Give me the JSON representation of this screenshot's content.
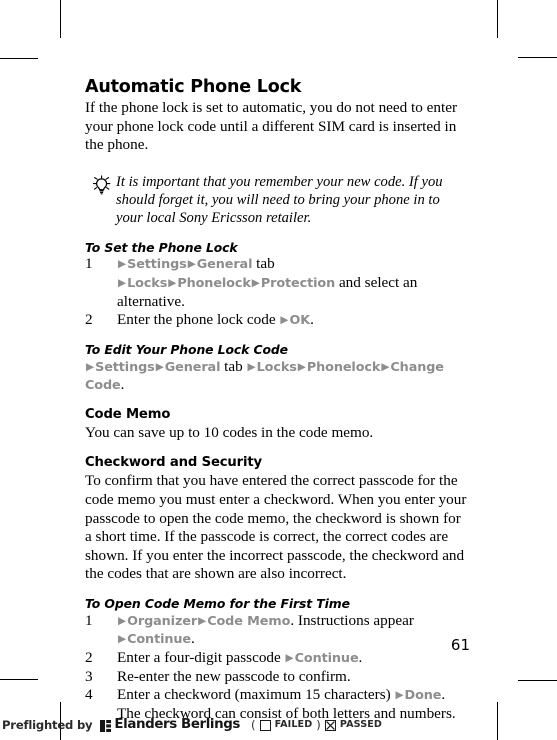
{
  "document": {
    "page_number": "61"
  },
  "sections": {
    "automatic_phone_lock": {
      "heading": "Automatic Phone Lock",
      "body": "If the phone lock is set to automatic, you do not need to enter your phone lock code until a different SIM card is inserted in the phone.",
      "tip": {
        "icon": "lightbulb-tip-icon",
        "text": "It is important that you remember your new code. If you should forget it, you will need to bring your phone in to your local Sony Ericsson retailer."
      }
    },
    "to_set_the_phone_lock": {
      "heading": "To Set the Phone Lock",
      "steps": [
        {
          "number": "1",
          "parts": [
            {
              "type": "arrow",
              "text": "▶"
            },
            {
              "type": "menu",
              "text": "Settings"
            },
            {
              "type": "arrow",
              "text": "▶"
            },
            {
              "type": "menu",
              "text": "General"
            },
            {
              "type": "text",
              "text": " tab "
            },
            {
              "type": "arrow",
              "text": "▶"
            },
            {
              "type": "menu",
              "text": "Locks"
            },
            {
              "type": "arrow",
              "text": "▶"
            },
            {
              "type": "menu",
              "text": "Phonelock"
            },
            {
              "type": "arrow",
              "text": "▶"
            },
            {
              "type": "menu",
              "text": "Protection"
            },
            {
              "type": "text",
              "text": " and select an alternative."
            }
          ]
        },
        {
          "number": "2",
          "parts": [
            {
              "type": "text",
              "text": "Enter the phone lock code "
            },
            {
              "type": "arrow",
              "text": "▶"
            },
            {
              "type": "menu",
              "text": "OK"
            },
            {
              "type": "text",
              "text": "."
            }
          ]
        }
      ]
    },
    "to_edit_your_phone_lock_code": {
      "heading": "To Edit Your Phone Lock Code",
      "path": [
        {
          "type": "arrow",
          "text": "▶"
        },
        {
          "type": "menu",
          "text": "Settings"
        },
        {
          "type": "arrow",
          "text": "▶"
        },
        {
          "type": "menu",
          "text": "General"
        },
        {
          "type": "text",
          "text": " tab "
        },
        {
          "type": "arrow",
          "text": "▶"
        },
        {
          "type": "menu",
          "text": "Locks"
        },
        {
          "type": "arrow",
          "text": "▶"
        },
        {
          "type": "menu",
          "text": "Phonelock"
        },
        {
          "type": "arrow",
          "text": "▶"
        },
        {
          "type": "menu",
          "text": "Change Code"
        },
        {
          "type": "text",
          "text": "."
        }
      ]
    },
    "code_memo": {
      "heading": "Code Memo",
      "body": "You can save up to 10 codes in the code memo."
    },
    "checkword_and_security": {
      "heading": "Checkword and Security",
      "body": "To confirm that you have entered the correct passcode for the code memo you must enter a checkword. When you enter your passcode to open the code memo, the checkword is shown for a short time. If the passcode is correct, the correct codes are shown. If you enter the incorrect passcode, the checkword and the codes that are shown are also incorrect."
    },
    "to_open_code_memo": {
      "heading": "To Open Code Memo for the First Time",
      "steps": [
        {
          "number": "1",
          "parts": [
            {
              "type": "arrow",
              "text": "▶"
            },
            {
              "type": "menu",
              "text": "Organizer"
            },
            {
              "type": "arrow",
              "text": "▶"
            },
            {
              "type": "menu",
              "text": "Code Memo"
            },
            {
              "type": "text",
              "text": ". Instructions appear "
            },
            {
              "type": "arrow",
              "text": "▶"
            },
            {
              "type": "menu",
              "text": "Continue"
            },
            {
              "type": "text",
              "text": "."
            }
          ]
        },
        {
          "number": "2",
          "parts": [
            {
              "type": "text",
              "text": "Enter a four-digit passcode "
            },
            {
              "type": "arrow",
              "text": "▶"
            },
            {
              "type": "menu",
              "text": "Continue"
            },
            {
              "type": "text",
              "text": "."
            }
          ]
        },
        {
          "number": "3",
          "parts": [
            {
              "type": "text",
              "text": "Re-enter the new passcode to confirm."
            }
          ]
        },
        {
          "number": "4",
          "parts": [
            {
              "type": "text",
              "text": "Enter a checkword (maximum 15 characters) "
            },
            {
              "type": "arrow",
              "text": "▶"
            },
            {
              "type": "menu",
              "text": "Done"
            },
            {
              "type": "text",
              "text": ". The checkword can consist of both letters and numbers."
            }
          ]
        }
      ]
    }
  },
  "preflight": {
    "label": "Preflighted by",
    "brand": "Elanders Berlings",
    "paren_open": "(",
    "failed_label": "FAILED",
    "paren_close": ")",
    "passed_label": "PASSED",
    "failed_checked": false,
    "passed_checked": true
  },
  "colors": {
    "menu_item": "#8d8d8d",
    "text": "#000000",
    "page_background": "#ffffff"
  }
}
